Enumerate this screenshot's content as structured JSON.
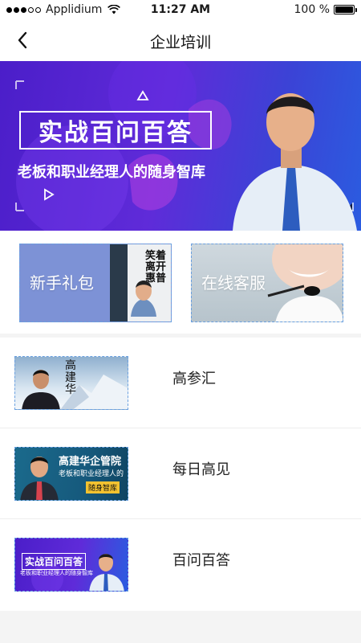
{
  "status": {
    "carrier": "Applidium",
    "time": "11:27 AM",
    "battery_text": "100 %",
    "battery_level": 1.0
  },
  "nav": {
    "title": "企业培训"
  },
  "banner": {
    "title": "实战百问百答",
    "subtitle": "老板和职业经理人的随身智库"
  },
  "quick_actions": [
    {
      "label": "新手礼包",
      "book_text": "笑着离开惠普"
    },
    {
      "label": "在线客服"
    }
  ],
  "list": [
    {
      "label": "高参汇",
      "thumb_text": "高建华"
    },
    {
      "label": "每日高见",
      "thumb_title": "高建华企管院",
      "thumb_line1": "老板和职业经理人的",
      "thumb_line2": "随身智库"
    },
    {
      "label": "百问百答",
      "thumb_title": "实战百问百答",
      "thumb_sub": "老板和职业经理人的随身智库"
    }
  ],
  "colors": {
    "banner_start": "#4b1ec9",
    "banner_end": "#2b5ce0",
    "card_border": "#6aa0e0"
  },
  "icons": [
    "back-arrow-icon",
    "wifi-icon",
    "battery-icon"
  ]
}
